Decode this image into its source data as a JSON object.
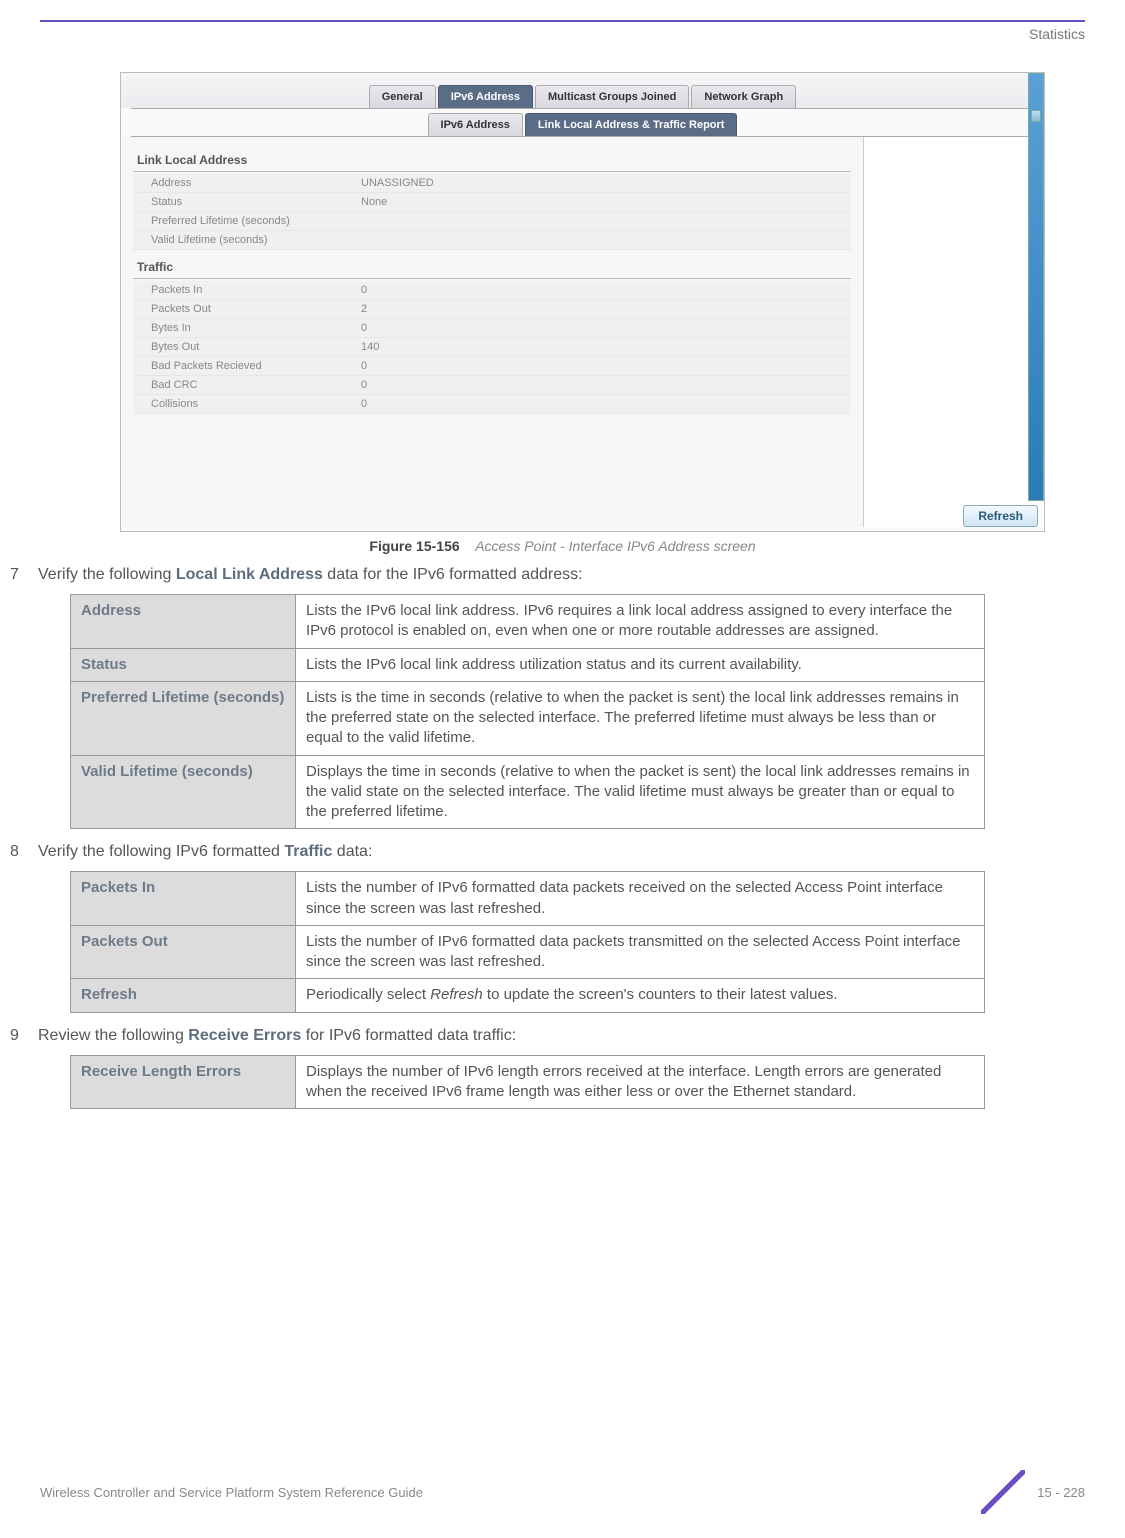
{
  "header": {
    "section": "Statistics"
  },
  "screenshot": {
    "tabs": {
      "general": "General",
      "ipv6_address": "IPv6 Address",
      "multicast": "Multicast Groups Joined",
      "network_graph": "Network Graph"
    },
    "subtabs": {
      "ipv6_address": "IPv6 Address",
      "link_local": "Link Local Address & Traffic Report"
    },
    "link_local": {
      "title": "Link Local Address",
      "rows": {
        "address": {
          "label": "Address",
          "value": "UNASSIGNED"
        },
        "status": {
          "label": "Status",
          "value": "None"
        },
        "pref": {
          "label": "Preferred Lifetime (seconds)",
          "value": ""
        },
        "valid": {
          "label": "Valid Lifetime (seconds)",
          "value": ""
        }
      }
    },
    "traffic": {
      "title": "Traffic",
      "rows": {
        "packets_in": {
          "label": "Packets In",
          "value": "0"
        },
        "packets_out": {
          "label": "Packets Out",
          "value": "2"
        },
        "bytes_in": {
          "label": "Bytes In",
          "value": "0"
        },
        "bytes_out": {
          "label": "Bytes Out",
          "value": "140"
        },
        "bad_packets": {
          "label": "Bad Packets Recieved",
          "value": "0"
        },
        "bad_crc": {
          "label": "Bad CRC",
          "value": "0"
        },
        "collisions": {
          "label": "Collisions",
          "value": "0"
        }
      }
    },
    "refresh": "Refresh"
  },
  "figure": {
    "label": "Figure 15-156",
    "desc": "Access Point - Interface IPv6 Address screen"
  },
  "step7": {
    "num": "7",
    "lead": "Verify the following ",
    "bold": "Local Link Address",
    "tail": " data for the IPv6 formatted address:",
    "table": {
      "address": {
        "term": "Address",
        "desc": "Lists the IPv6 local link address. IPv6 requires a link local address assigned to every interface the IPv6 protocol is enabled on, even when one or more routable addresses are assigned."
      },
      "status": {
        "term": "Status",
        "desc": "Lists the IPv6 local link address utilization status and its current availability."
      },
      "pref": {
        "term": "Preferred Lifetime (seconds)",
        "desc": "Lists is the time in seconds (relative to when the packet is sent) the local link addresses remains in the preferred state on the selected interface. The preferred lifetime must always be less than or equal to the valid lifetime."
      },
      "valid": {
        "term": "Valid Lifetime (seconds)",
        "desc": "Displays the time in seconds (relative to when the packet is sent) the local link addresses remains in the valid state on the selected interface. The valid lifetime must always be greater than or equal to the preferred lifetime."
      }
    }
  },
  "step8": {
    "num": "8",
    "lead": "Verify the following IPv6 formatted ",
    "bold": "Traffic",
    "tail": " data:",
    "table": {
      "packets_in": {
        "term": "Packets In",
        "desc": "Lists the number of IPv6 formatted data packets received on the selected Access Point interface since the screen was last refreshed."
      },
      "packets_out": {
        "term": "Packets Out",
        "desc": "Lists the number of IPv6 formatted data packets transmitted on the selected Access Point interface since the screen was last refreshed."
      },
      "refresh": {
        "term": "Refresh",
        "desc_lead": "Periodically select ",
        "desc_em": "Refresh",
        "desc_tail": " to update the screen's counters to their latest values."
      }
    }
  },
  "step9": {
    "num": "9",
    "lead": "Review the following ",
    "bold": "Receive Errors",
    "tail": " for IPv6 formatted data traffic:",
    "table": {
      "recv_len": {
        "term": "Receive Length Errors",
        "desc": "Displays the number of IPv6 length errors received at the interface. Length errors are generated when the received IPv6 frame length was either less or over the Ethernet standard."
      }
    }
  },
  "footer": {
    "title": "Wireless Controller and Service Platform System Reference Guide",
    "page": "15 - 228"
  }
}
